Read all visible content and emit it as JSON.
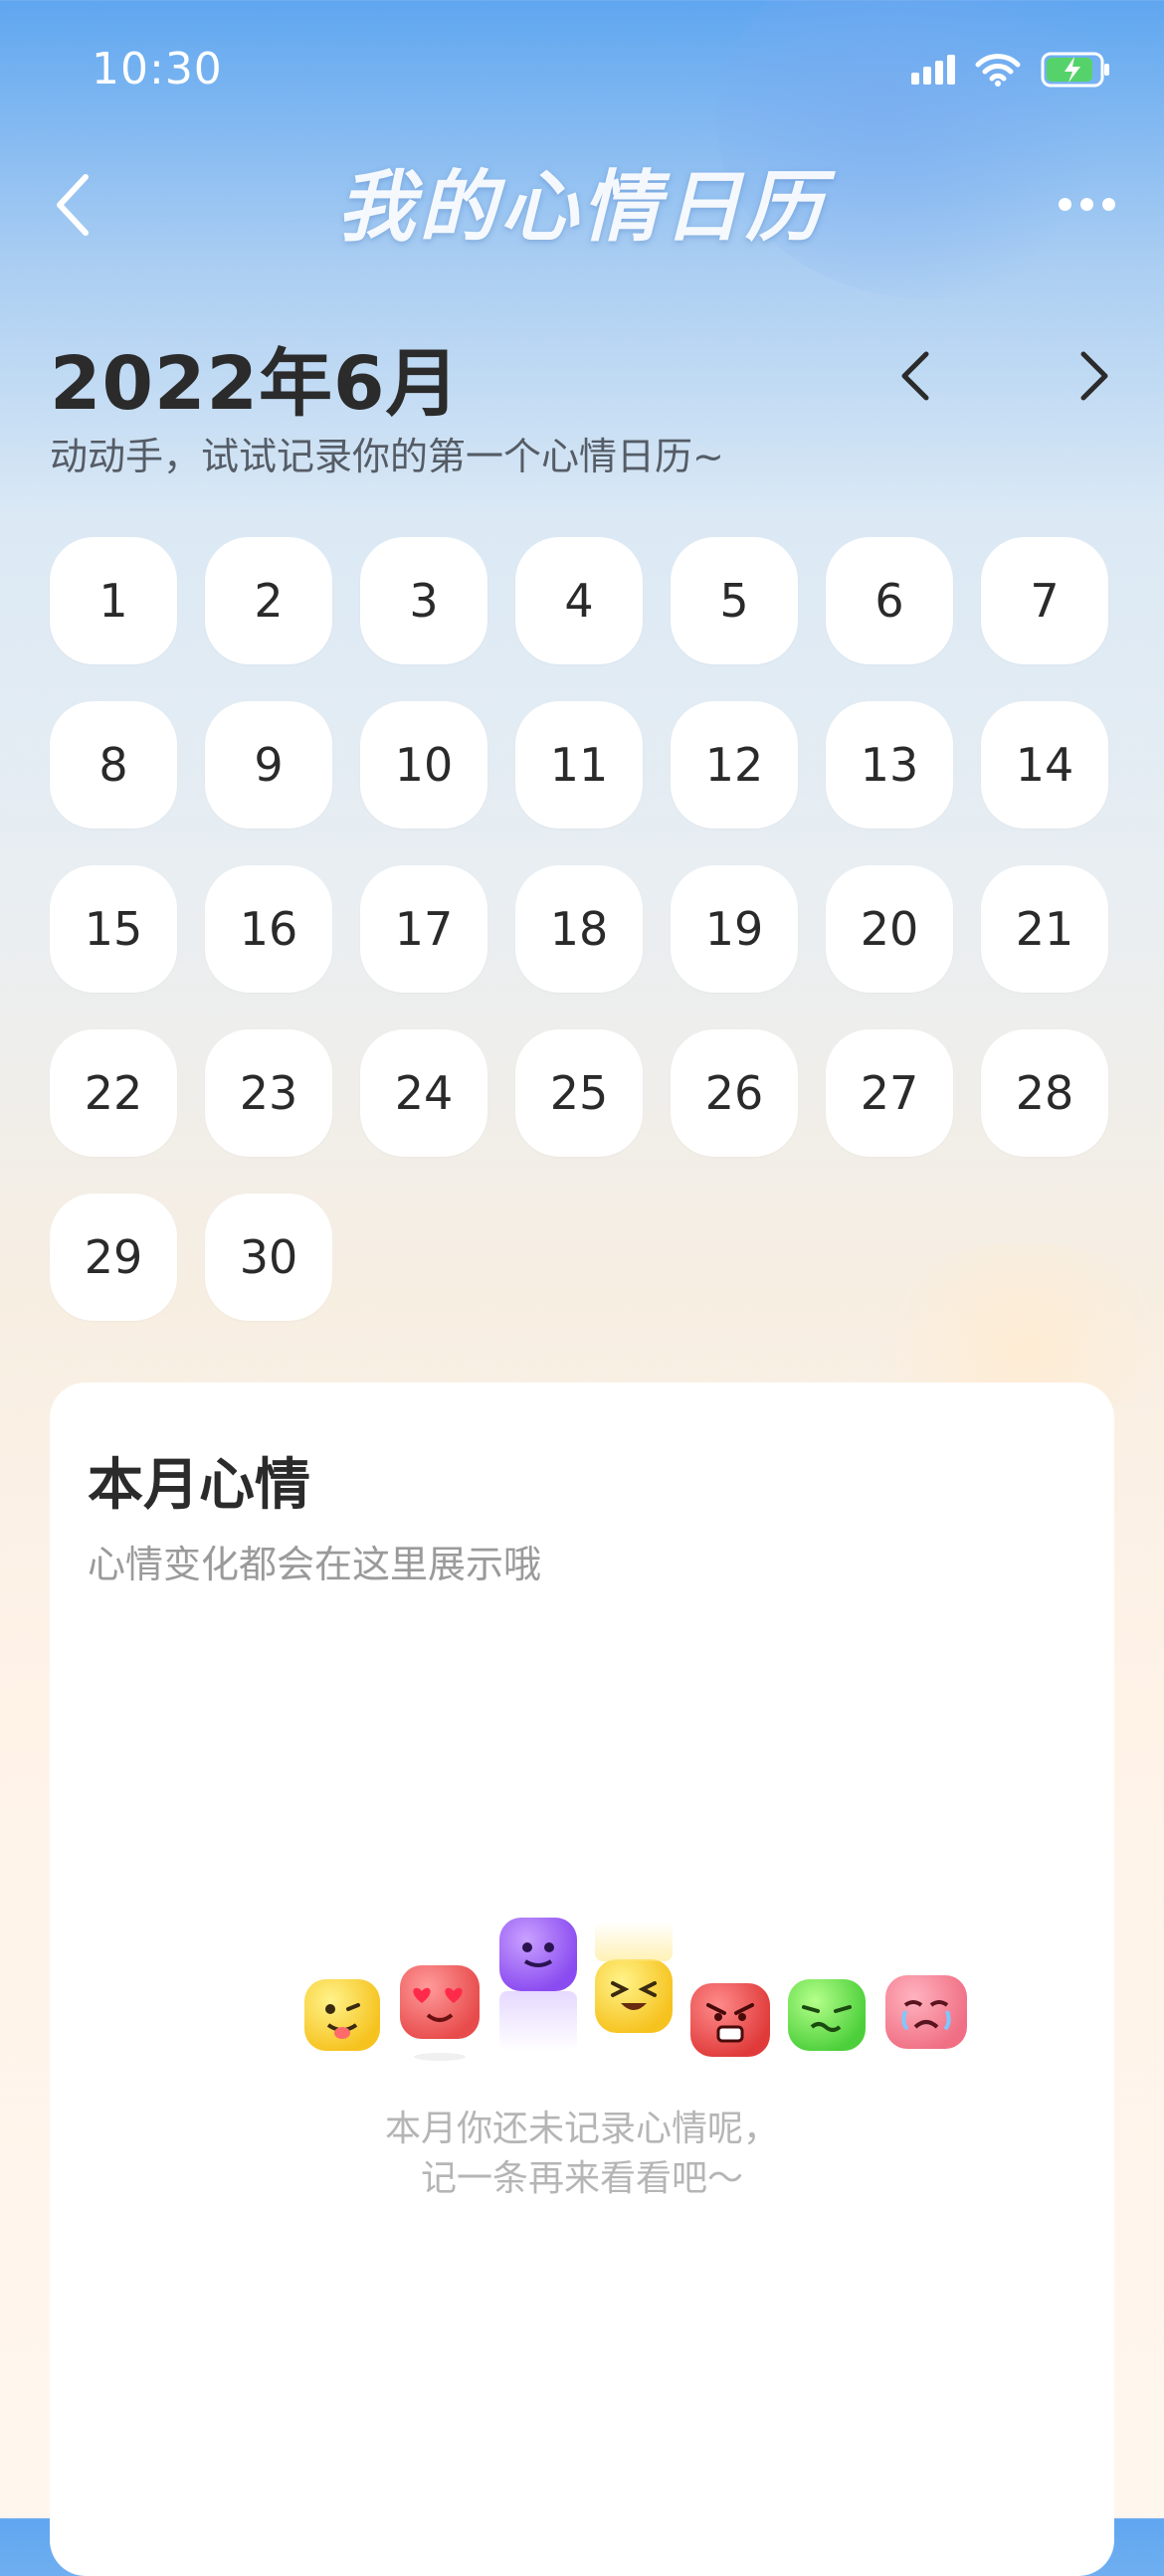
{
  "status_bar": {
    "time": "10:30"
  },
  "header": {
    "title": "我的心情日历"
  },
  "calendar": {
    "month_title": "2022年6月",
    "subtitle": "动动手，试试记录你的第一个心情日历~",
    "days": [
      "1",
      "2",
      "3",
      "4",
      "5",
      "6",
      "7",
      "8",
      "9",
      "10",
      "11",
      "12",
      "13",
      "14",
      "15",
      "16",
      "17",
      "18",
      "19",
      "20",
      "21",
      "22",
      "23",
      "24",
      "25",
      "26",
      "27",
      "28",
      "29",
      "30"
    ]
  },
  "mood_card": {
    "title": "本月心情",
    "subtitle": "心情变化都会在这里展示哦",
    "empty_line1": "本月你还未记录心情呢，",
    "empty_line2": "记一条再来看看吧～",
    "emoji_icons": [
      "playful-face-icon",
      "heart-eyes-face-icon",
      "purple-smile-face-icon",
      "laughing-face-icon",
      "angry-face-icon",
      "nauseated-face-icon",
      "crying-face-icon"
    ]
  },
  "colors": {
    "accent_blue": "#5fa6f0",
    "day_cell": "#ffffff",
    "text_primary": "#2b2b2b",
    "text_muted": "#9a9a9a"
  }
}
